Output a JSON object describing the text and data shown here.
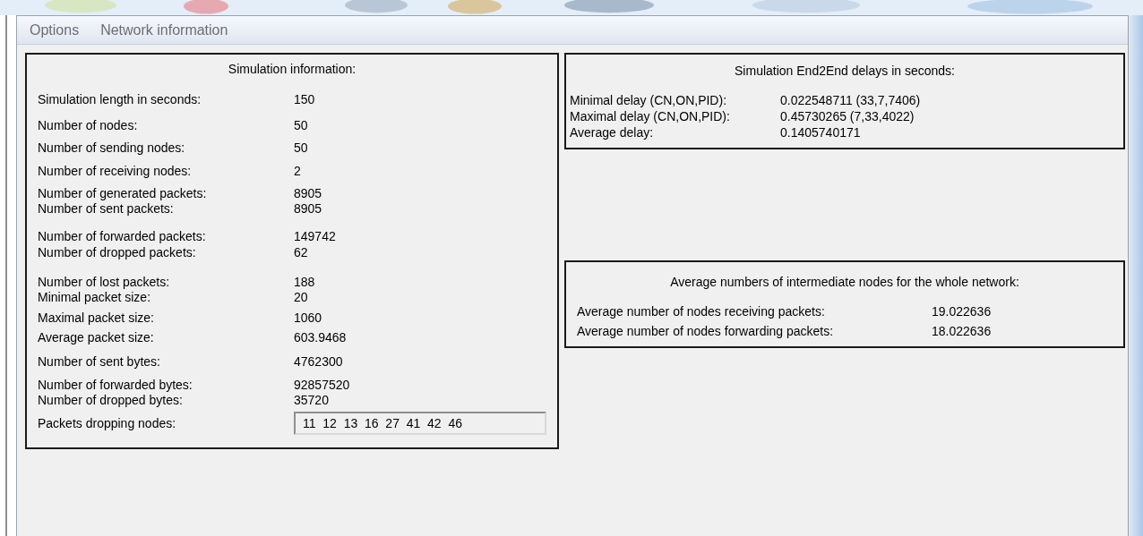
{
  "menu": [
    "Options",
    "Network information"
  ],
  "simulation_info": {
    "title": "Simulation information:",
    "rows": [
      {
        "label": "Simulation length in seconds:",
        "value": "150"
      },
      {
        "label": "Number of nodes:",
        "value": "50"
      },
      {
        "label": "Number of sending nodes:",
        "value": "50"
      },
      {
        "label": "Number of receiving nodes:",
        "value": "2"
      },
      {
        "label": "Number of generated packets:",
        "value": "8905"
      },
      {
        "label": "Number of sent packets:",
        "value": "8905"
      },
      {
        "label": "Number of forwarded packets:",
        "value": "149742"
      },
      {
        "label": "Number of dropped packets:",
        "value": "62"
      },
      {
        "label": "Number of lost packets:",
        "value": "188"
      },
      {
        "label": "Minimal packet size:",
        "value": "20"
      },
      {
        "label": "Maximal packet size:",
        "value": "1060"
      },
      {
        "label": "Average packet size:",
        "value": "603.9468"
      },
      {
        "label": "Number of sent bytes:",
        "value": "4762300"
      },
      {
        "label": "Number of forwarded bytes:",
        "value": "92857520"
      },
      {
        "label": "Number of dropped bytes:",
        "value": "35720"
      }
    ],
    "dropping_nodes": {
      "label": "Packets dropping nodes:",
      "value": "11  12  13  16  27  41  42  46"
    }
  },
  "delays": {
    "title": "Simulation End2End delays in seconds:",
    "rows": [
      {
        "label": "Minimal delay (CN,ON,PID):",
        "value": "0.022548711 (33,7,7406)"
      },
      {
        "label": "Maximal delay (CN,ON,PID):",
        "value": "0.45730265 (7,33,4022)"
      },
      {
        "label": "Average delay:",
        "value": "0.1405740171"
      }
    ]
  },
  "intermediate": {
    "title": "Average numbers of intermediate nodes for the whole network:",
    "rows": [
      {
        "label": "Average number of nodes receiving packets:",
        "value": "19.022636"
      },
      {
        "label": "Average number of nodes forwarding packets:",
        "value": "18.022636"
      }
    ]
  }
}
